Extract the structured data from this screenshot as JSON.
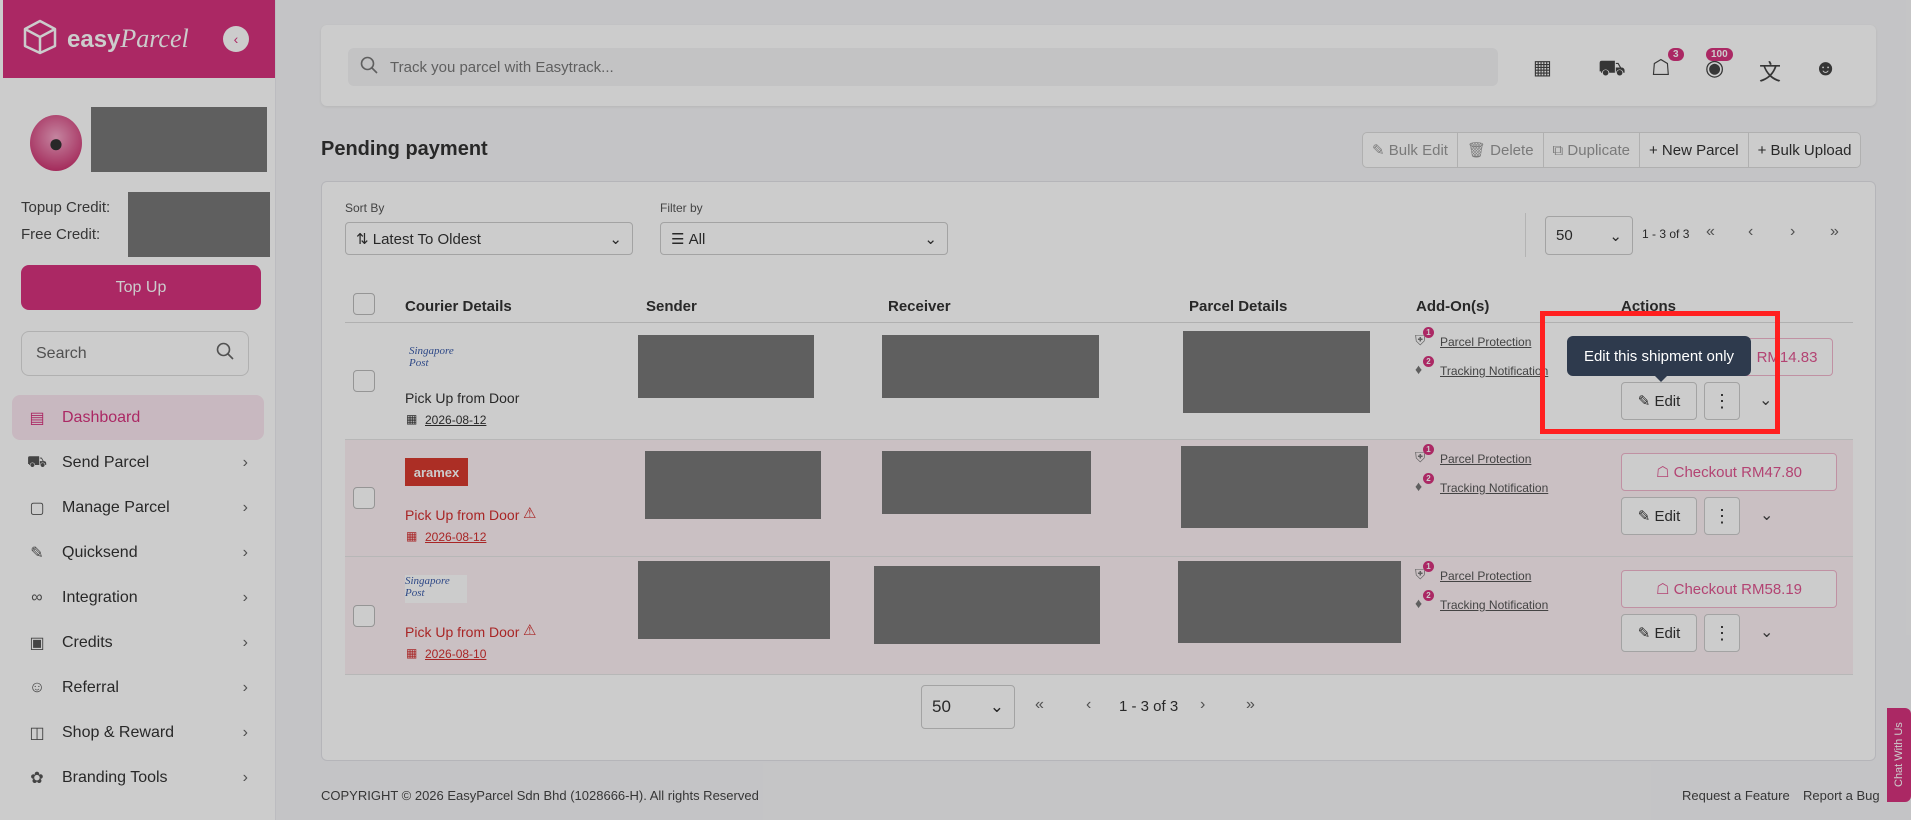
{
  "brand": {
    "name_bold": "easy",
    "name_script": "Parcel"
  },
  "sidebar": {
    "topup_credit_label": "Topup Credit:",
    "free_credit_label": "Free Credit:",
    "topup_button": "Top Up",
    "search_placeholder": "Search",
    "items": [
      {
        "label": "Dashboard",
        "icon": "chart-bar-icon",
        "active": true
      },
      {
        "label": "Send Parcel",
        "icon": "truck-icon"
      },
      {
        "label": "Manage Parcel",
        "icon": "box-icon"
      },
      {
        "label": "Quicksend",
        "icon": "quicksend-icon"
      },
      {
        "label": "Integration",
        "icon": "link-icon"
      },
      {
        "label": "Credits",
        "icon": "wallet-icon"
      },
      {
        "label": "Referral",
        "icon": "user-plus-icon"
      },
      {
        "label": "Shop & Reward",
        "icon": "shopping-bag-icon"
      },
      {
        "label": "Branding Tools",
        "icon": "palette-icon"
      }
    ]
  },
  "topbar": {
    "track_placeholder": "Track you parcel with Easytrack...",
    "cart_count": "3",
    "notification_count": "100"
  },
  "page": {
    "title": "Pending payment",
    "toolbar": {
      "bulk_edit": "Bulk Edit",
      "delete": "Delete",
      "duplicate": "Duplicate",
      "new_parcel": "New Parcel",
      "bulk_upload": "Bulk Upload"
    }
  },
  "filters": {
    "sort_label": "Sort By",
    "sort_value": "Latest To Oldest",
    "filter_label": "Filter by",
    "filter_value": "All",
    "page_size": "50",
    "range_top": "1 - 3 of 3"
  },
  "table": {
    "columns": [
      "Courier Details",
      "Sender",
      "Receiver",
      "Parcel Details",
      "Add-On(s)",
      "Actions"
    ],
    "addons": {
      "protection": "Parcel Protection",
      "tracking": "Tracking Notification",
      "protection_count": "1",
      "tracking_count": "2"
    },
    "edit_label": "Edit",
    "rows": [
      {
        "courier": "Singapore Post",
        "pickup": "Pick Up from Door",
        "date": "2026-08-12",
        "checkout": "RM14.83",
        "warning": false
      },
      {
        "courier": "aramex",
        "pickup": "Pick Up from Door",
        "date": "2026-08-12",
        "checkout": "Checkout RM47.80",
        "warning": true
      },
      {
        "courier": "Singapore Post",
        "pickup": "Pick Up from Door",
        "date": "2026-08-10",
        "checkout": "Checkout RM58.19",
        "warning": true
      }
    ]
  },
  "pagination": {
    "page_size": "50",
    "range": "1 - 3 of 3"
  },
  "footer": {
    "copyright": "COPYRIGHT © 2026 EasyParcel Sdn Bhd (1028666-H). All rights Reserved",
    "request_feature": "Request a Feature",
    "report_bug": "Report a Bug",
    "chat": "Chat With Us"
  },
  "tooltip": {
    "text": "Edit this shipment only"
  },
  "colors": {
    "brand": "#d6337e",
    "highlight": "#ff1f1f",
    "tooltip": "#2e3a4d"
  }
}
